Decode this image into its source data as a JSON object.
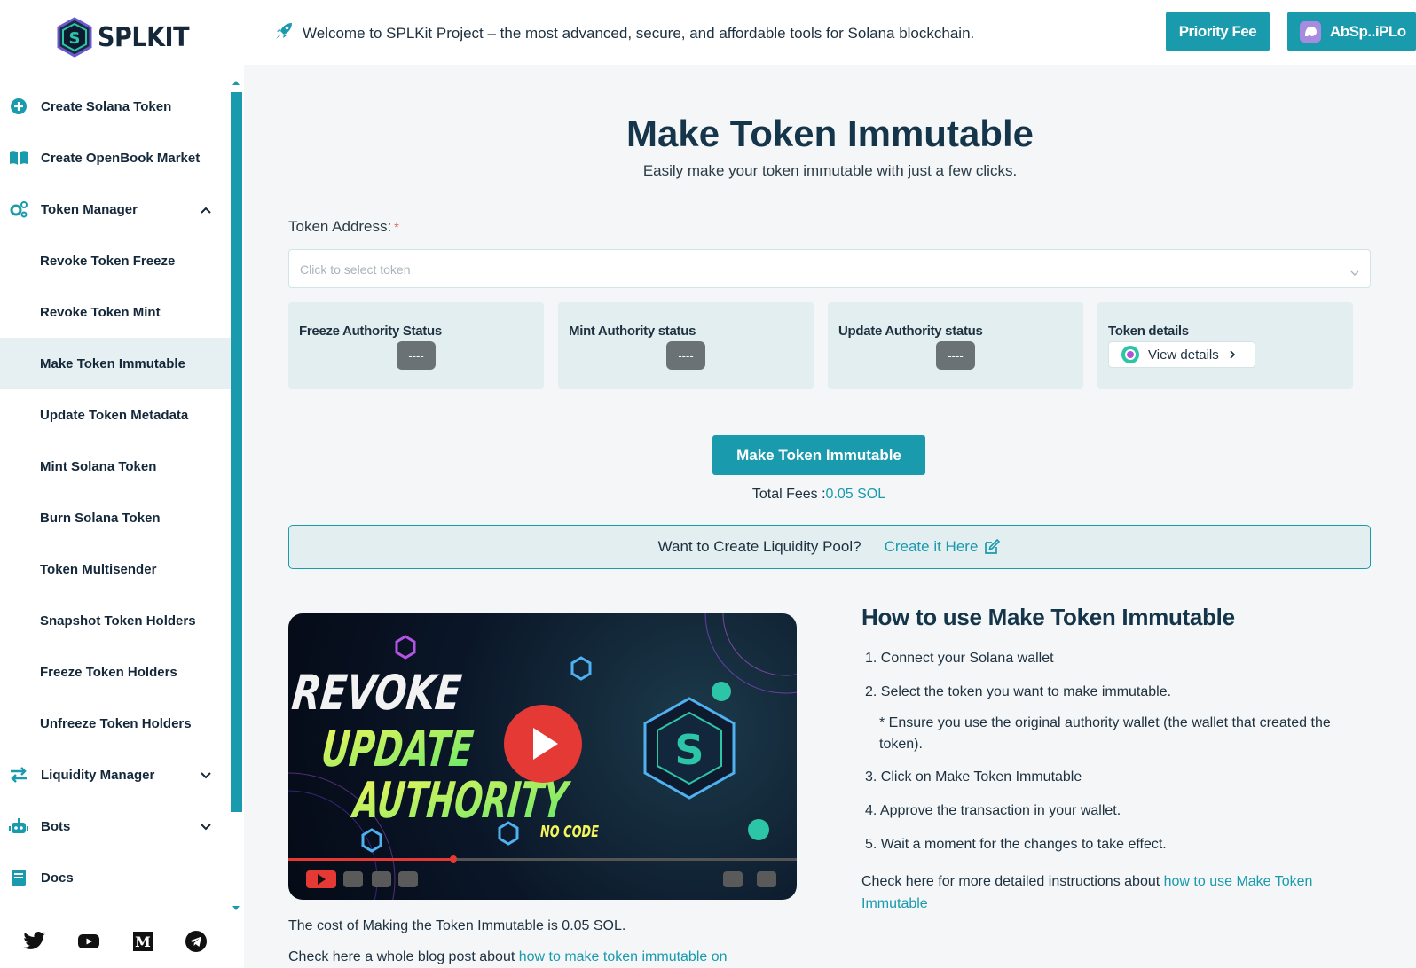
{
  "brand": {
    "name": "SPLKIT"
  },
  "header": {
    "welcome": "Welcome to SPLKit Project – the most advanced, secure, and affordable tools for Solana blockchain.",
    "priority_fee_label": "Priority Fee",
    "wallet_label": "AbSp..iPLo"
  },
  "sidebar": {
    "items": [
      {
        "label": "Create Solana Token",
        "icon": "plus-circle-icon"
      },
      {
        "label": "Create OpenBook Market",
        "icon": "book-open-icon"
      },
      {
        "label": "Token Manager",
        "icon": "gears-icon"
      },
      {
        "label": "Revoke Token Freeze"
      },
      {
        "label": "Revoke Token Mint"
      },
      {
        "label": "Make Token Immutable"
      },
      {
        "label": "Update Token Metadata"
      },
      {
        "label": "Mint Solana Token"
      },
      {
        "label": "Burn Solana Token"
      },
      {
        "label": "Token Multisender"
      },
      {
        "label": "Snapshot Token Holders"
      },
      {
        "label": "Freeze Token Holders"
      },
      {
        "label": "Unfreeze Token Holders"
      },
      {
        "label": "Liquidity Manager",
        "icon": "swap-arrows-icon"
      },
      {
        "label": "Bots",
        "icon": "robot-icon"
      },
      {
        "label": "Docs",
        "icon": "book-icon"
      }
    ],
    "active": "Make Token Immutable",
    "social": [
      "twitter-icon",
      "youtube-icon",
      "medium-icon",
      "telegram-icon"
    ]
  },
  "main": {
    "title": "Make Token Immutable",
    "subtitle": "Easily make your token immutable with just a few clicks.",
    "token_address_label": "Token Address:",
    "required_mark": "*",
    "token_select_placeholder": "Click to select token",
    "cards": {
      "freeze": {
        "title": "Freeze Authority Status",
        "value": "----"
      },
      "mint": {
        "title": "Mint Authority status",
        "value": "----"
      },
      "update": {
        "title": "Update Authority status",
        "value": "----"
      },
      "details": {
        "title": "Token details",
        "link": "View details"
      }
    },
    "cta_label": "Make Token Immutable",
    "fees_label": "Total Fees :",
    "fees_value": "0.05 SOL",
    "liquidity_prompt": "Want to Create Liquidity Pool?",
    "liquidity_link": "Create it Here",
    "video": {
      "line1": "REVOKE",
      "line2": "UPDATE",
      "line3": "AUTHORITY",
      "tag": "NO CODE",
      "logo_letter": "S"
    },
    "cost_text": "The cost of Making the Token Immutable is 0.05 SOL.",
    "blog_prefix": "Check here a whole blog post about ",
    "blog_link": "how to make token immutable on"
  },
  "howto": {
    "title": "How to use Make Token Immutable",
    "steps": [
      "1. Connect your Solana wallet",
      "2. Select the token you want to make immutable.",
      "3. Click on Make Token Immutable",
      "4. Approve the transaction in your wallet.",
      "5. Wait a moment for the changes to take effect."
    ],
    "note": "* Ensure you use the original authority wallet (the wallet that created the token).",
    "more_prefix": "Check here for more detailed instructions about ",
    "more_link": "how to use Make Token Immutable"
  },
  "colors": {
    "accent": "#1a9aad",
    "title": "#15364a",
    "card_bg": "#e3eef0"
  }
}
